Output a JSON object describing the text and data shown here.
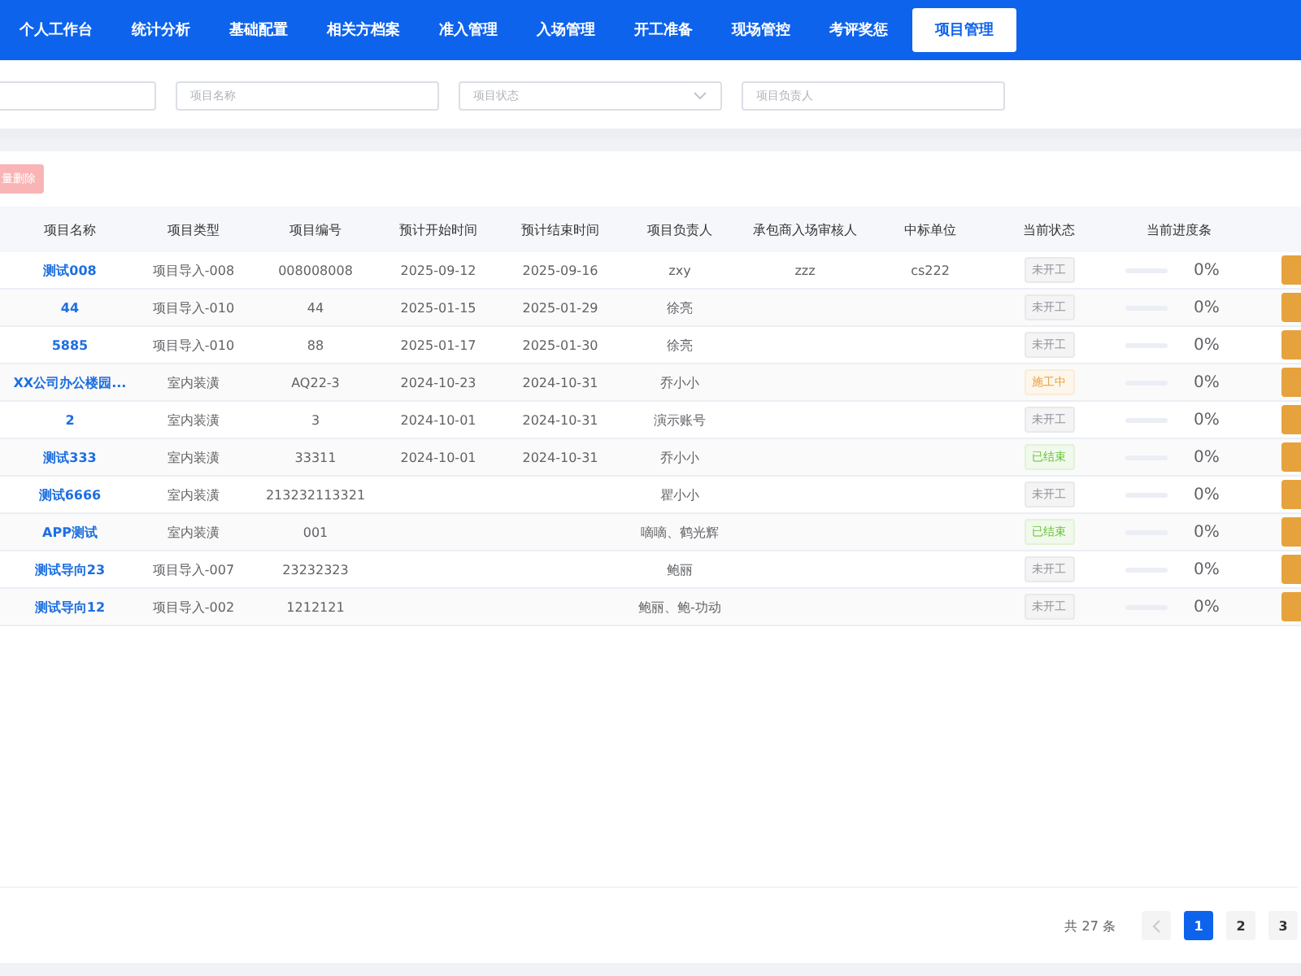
{
  "header": {
    "nav": [
      {
        "label": "个人工作台",
        "selected": false
      },
      {
        "label": "统计分析",
        "selected": false
      },
      {
        "label": "基础配置",
        "selected": false
      },
      {
        "label": "相关方档案",
        "selected": false
      },
      {
        "label": "准入管理",
        "selected": false
      },
      {
        "label": "入场管理",
        "selected": false
      },
      {
        "label": "开工准备",
        "selected": false
      },
      {
        "label": "现场管控",
        "selected": false
      },
      {
        "label": "考评奖惩",
        "selected": false
      },
      {
        "label": "项目管理",
        "selected": true
      }
    ]
  },
  "filters": [
    {
      "kind": "input"
    },
    {
      "kind": "input",
      "placeholder": "项目名称"
    },
    {
      "kind": "select",
      "placeholder": "项目状态"
    },
    {
      "kind": "input",
      "placeholder": "项目负责人"
    }
  ],
  "batch_delete_button": "量删除",
  "table": {
    "columns": [
      "",
      "项目名称",
      "项目类型",
      "项目编号",
      "预计开始时间",
      "预计结束时间",
      "项目负责人",
      "承包商入场审核人",
      "中标单位",
      "当前状态",
      "当前进度条",
      ""
    ],
    "rows": [
      {
        "name": "测试008",
        "type": "项目导入-008",
        "code": "008008008",
        "start": "2025-09-12",
        "end": "2025-09-16",
        "owner": "zxy",
        "reviewer": "zzz",
        "bid_unit": "cs222",
        "status": {
          "kind": "not_started",
          "label": "未开工"
        },
        "level": 0,
        "percent": "0%"
      },
      {
        "name": "44",
        "type": "项目导入-010",
        "code": "44",
        "start": "2025-01-15",
        "end": "2025-01-29",
        "owner": "徐亮",
        "status": {
          "kind": "not_started",
          "label": "未开工"
        },
        "level": 0,
        "percent": "0%"
      },
      {
        "name": "5885",
        "type": "项目导入-010",
        "code": "88",
        "start": "2025-01-17",
        "end": "2025-01-30",
        "owner": "徐亮",
        "status": {
          "kind": "not_started",
          "label": "未开工"
        },
        "level": 0,
        "percent": "0%"
      },
      {
        "name": "XX公司办公楼园...",
        "type": "室内装潢",
        "code": "AQ22-3",
        "start": "2024-10-23",
        "end": "2024-10-31",
        "owner": "乔小小",
        "status": {
          "kind": "in_progress",
          "label": "施工中"
        },
        "level": 0,
        "percent": "0%"
      },
      {
        "name": "2",
        "type": "室内装潢",
        "code": "3",
        "start": "2024-10-01",
        "end": "2024-10-31",
        "owner": "演示账号",
        "status": {
          "kind": "not_started",
          "label": "未开工"
        },
        "level": 0,
        "percent": "0%"
      },
      {
        "name": "测试333",
        "type": "室内装潢",
        "code": "33311",
        "start": "2024-10-01",
        "end": "2024-10-31",
        "owner": "乔小小",
        "status": {
          "kind": "finished",
          "label": "已结束"
        },
        "level": 0,
        "percent": "0%"
      },
      {
        "name": "测试6666",
        "type": "室内装潢",
        "code": "213232113321",
        "owner": "瞿小小",
        "status": {
          "kind": "not_started",
          "label": "未开工"
        },
        "level": 0,
        "percent": "0%"
      },
      {
        "name": "APP测试",
        "type": "室内装潢",
        "code": "001",
        "owner": "嘀嘀、鹤光辉",
        "status": {
          "kind": "finished",
          "label": "已结束"
        },
        "level": 0,
        "percent": "0%"
      },
      {
        "name": "测试导向23",
        "type": "项目导入-007",
        "code": "23232323",
        "owner": "鲍丽",
        "status": {
          "kind": "not_started",
          "label": "未开工"
        },
        "level": 0,
        "percent": "0%"
      },
      {
        "name": "测试导向12",
        "type": "项目导入-002",
        "code": "1212121",
        "owner": "鲍丽、鲍-功动",
        "status": {
          "kind": "not_started",
          "label": "未开工"
        },
        "level": 0,
        "percent": "0%"
      }
    ]
  },
  "pagination": {
    "total": "共 27 条",
    "pages": [
      {
        "label": "1",
        "selected": true
      },
      {
        "label": "2",
        "selected": false
      },
      {
        "label": "3",
        "selected": false
      }
    ]
  }
}
